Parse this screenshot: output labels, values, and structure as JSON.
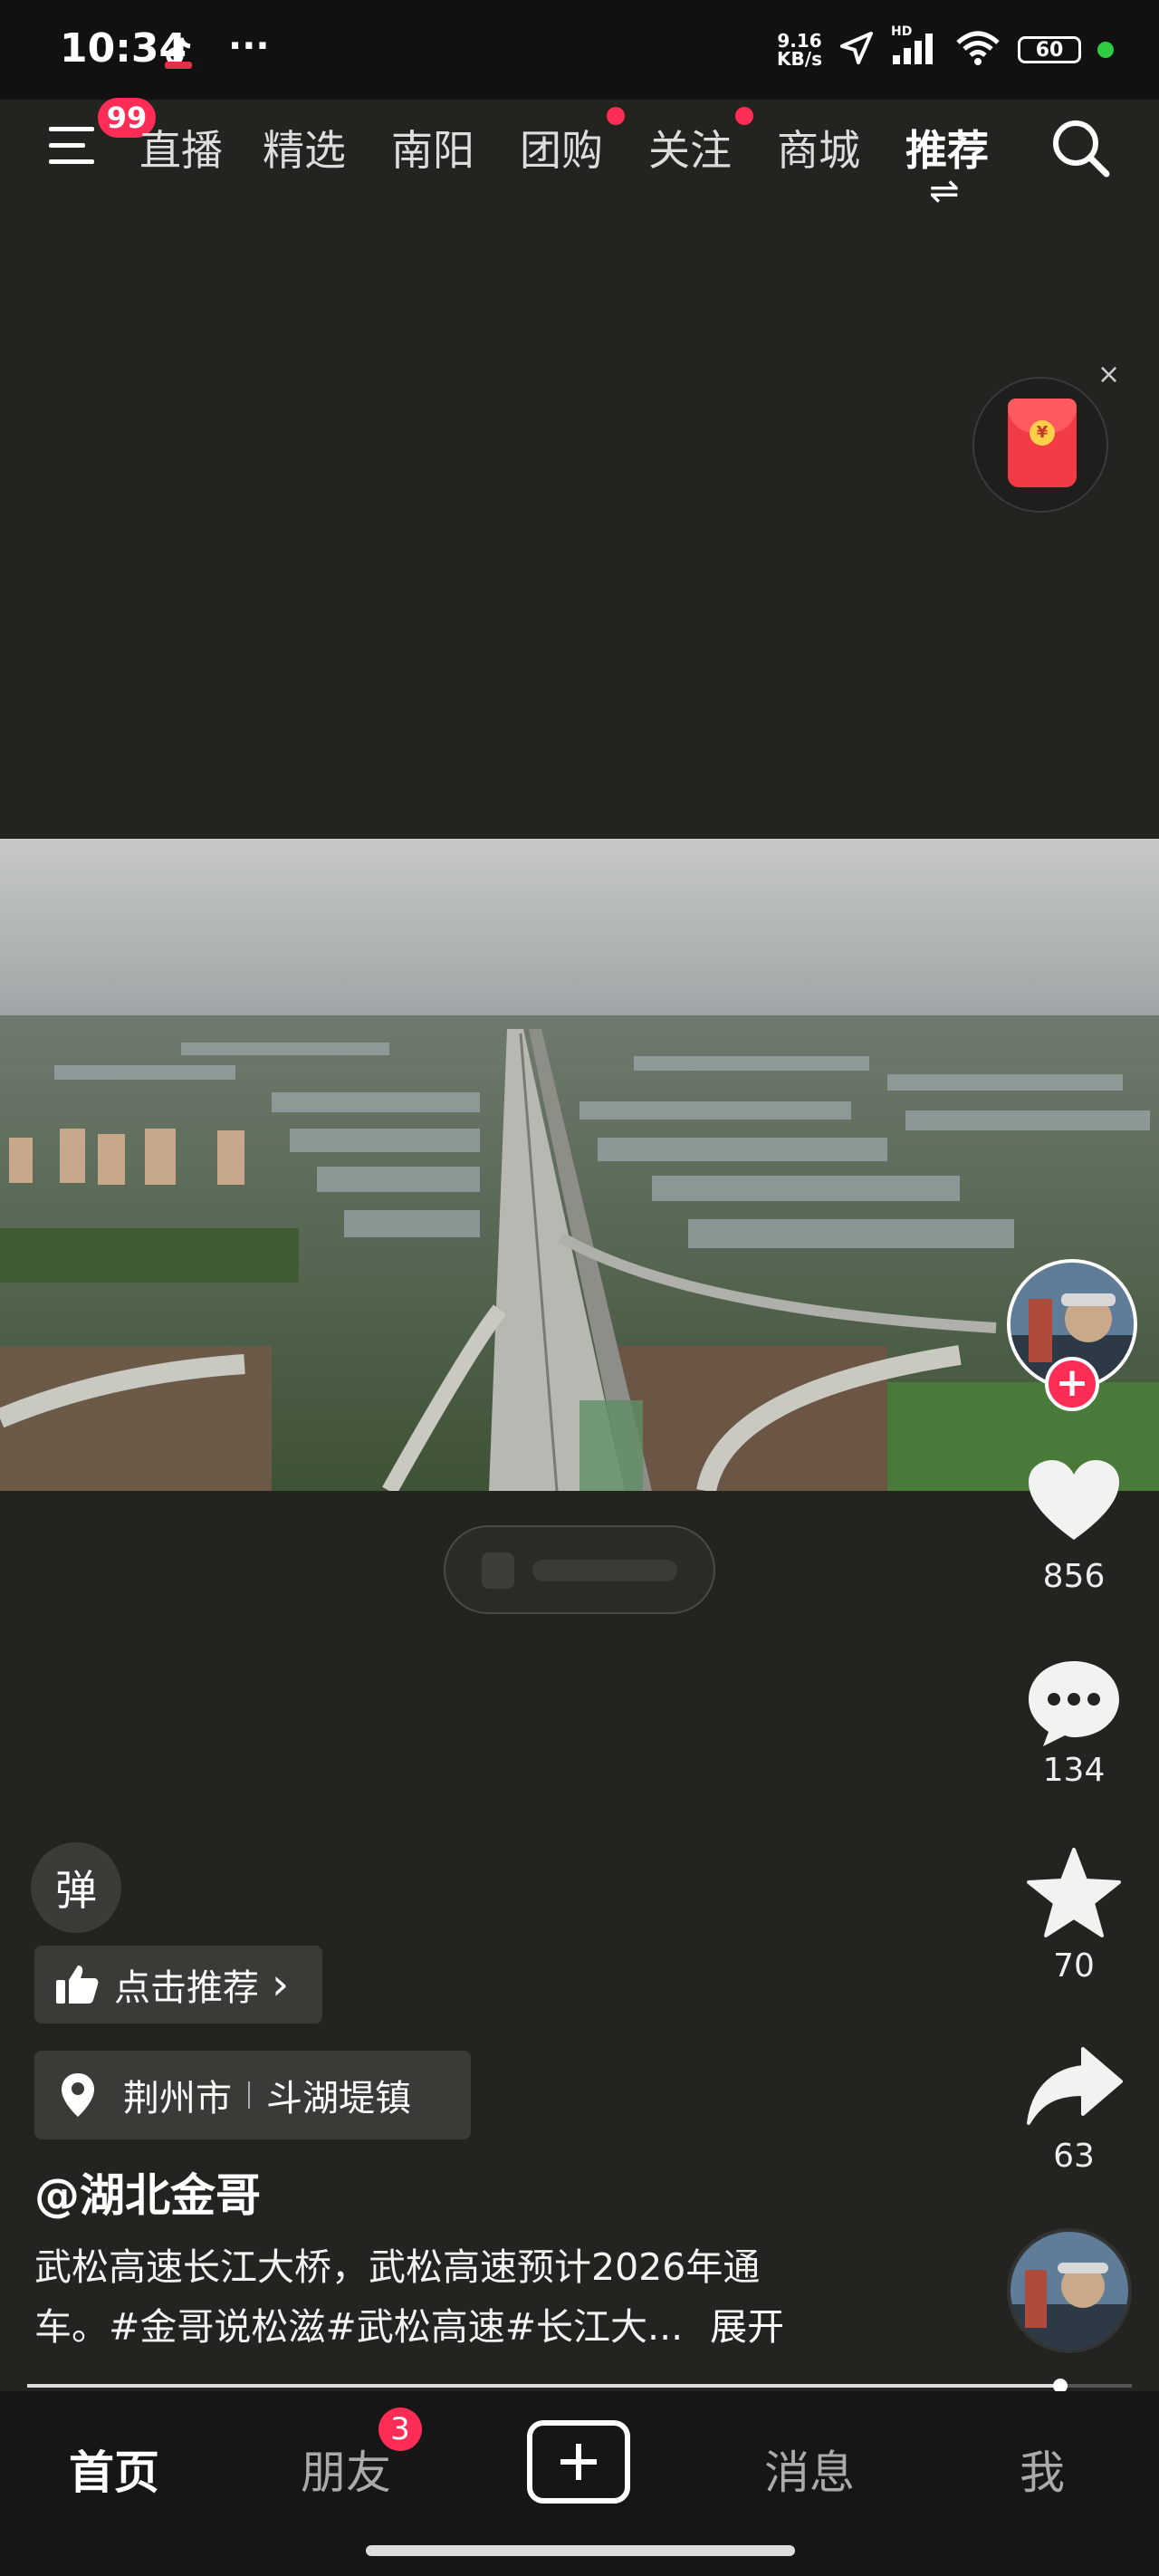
{
  "status_bar": {
    "time": "10:34",
    "more": "···",
    "net_speed_value": "9.16",
    "net_speed_unit": "KB/s",
    "battery": "60",
    "hd_label": "HD"
  },
  "top_nav": {
    "menu_badge": "99",
    "tabs": [
      {
        "label": "直播"
      },
      {
        "label": "精选"
      },
      {
        "label": "南阳"
      },
      {
        "label": "团购"
      },
      {
        "label": "关注"
      },
      {
        "label": "商城"
      },
      {
        "label": "推荐"
      }
    ],
    "swap_glyph": "⇌"
  },
  "red_packet": {
    "close": "×",
    "symbol": "¥"
  },
  "danmaku": {
    "label": "弹"
  },
  "recommend_chip": {
    "label": "点击推荐",
    "chevron": "›"
  },
  "location_chip": {
    "city": "荆州市",
    "town": "斗湖堤镇"
  },
  "post": {
    "author": "@湖北金哥",
    "desc_line1": "武松高速长江大桥，武松高速预计2026年通",
    "desc_line2": "车。#金哥说松滋#武松高速#长江大...",
    "expand": "展开"
  },
  "actions": {
    "likes": "856",
    "comments": "134",
    "favorites": "70",
    "shares": "63"
  },
  "progress_fraction": 0.935,
  "bottom_nav": {
    "home": "首页",
    "friends": "朋友",
    "friends_badge": "3",
    "messages": "消息",
    "me": "我"
  },
  "colors": {
    "accent": "#ff2c55",
    "background": "#232320"
  }
}
